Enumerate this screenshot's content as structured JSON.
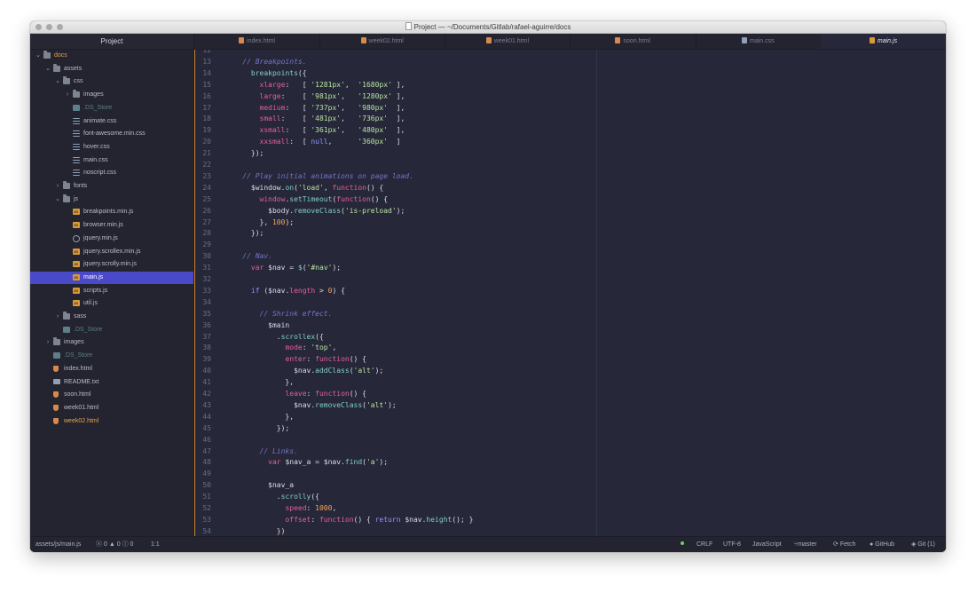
{
  "window": {
    "title": "Project — ~/Documents/Gitlab/rafael-aguirre/docs"
  },
  "tree": {
    "header": "Project",
    "items": [
      {
        "label": "docs",
        "icon": "folder-icon",
        "type": "folder",
        "expanded": true,
        "depth": 0,
        "style": "orange"
      },
      {
        "label": "assets",
        "icon": "folder-icon",
        "type": "folder",
        "expanded": true,
        "depth": 1,
        "style": ""
      },
      {
        "label": "css",
        "icon": "folder-icon",
        "type": "folder",
        "expanded": true,
        "depth": 2,
        "style": ""
      },
      {
        "label": "images",
        "icon": "folder-icon",
        "type": "folder",
        "expanded": false,
        "depth": 3,
        "style": ""
      },
      {
        "label": ".DS_Store",
        "icon": "ds-store-icon",
        "type": "ds",
        "depth": 3,
        "style": "dim"
      },
      {
        "label": "animate.css",
        "icon": "css-file-icon",
        "type": "css",
        "depth": 3,
        "style": ""
      },
      {
        "label": "font-awesome.min.css",
        "icon": "css-file-icon",
        "type": "css",
        "depth": 3,
        "style": ""
      },
      {
        "label": "hover.css",
        "icon": "css-file-icon",
        "type": "css",
        "depth": 3,
        "style": ""
      },
      {
        "label": "main.css",
        "icon": "css-file-icon",
        "type": "css",
        "depth": 3,
        "style": ""
      },
      {
        "label": "noscript.css",
        "icon": "css-file-icon",
        "type": "css",
        "depth": 3,
        "style": ""
      },
      {
        "label": "fonts",
        "icon": "folder-icon",
        "type": "folder",
        "expanded": false,
        "depth": 2,
        "style": ""
      },
      {
        "label": "js",
        "icon": "folder-icon",
        "type": "folder",
        "expanded": true,
        "depth": 2,
        "style": ""
      },
      {
        "label": "breakpoints.min.js",
        "icon": "js-file-icon",
        "type": "js",
        "depth": 3,
        "style": ""
      },
      {
        "label": "browser.min.js",
        "icon": "js-file-icon",
        "type": "js",
        "depth": 3,
        "style": ""
      },
      {
        "label": "jquery.min.js",
        "icon": "jquery-file-icon",
        "type": "jq",
        "depth": 3,
        "style": ""
      },
      {
        "label": "jquery.scrollex.min.js",
        "icon": "js-file-icon",
        "type": "js",
        "depth": 3,
        "style": ""
      },
      {
        "label": "jquery.scrolly.min.js",
        "icon": "js-file-icon",
        "type": "js",
        "depth": 3,
        "style": ""
      },
      {
        "label": "main.js",
        "icon": "js-file-icon",
        "type": "js",
        "depth": 3,
        "style": "selected"
      },
      {
        "label": "scripts.js",
        "icon": "js-file-icon",
        "type": "js",
        "depth": 3,
        "style": ""
      },
      {
        "label": "util.js",
        "icon": "js-file-icon",
        "type": "js",
        "depth": 3,
        "style": ""
      },
      {
        "label": "sass",
        "icon": "folder-icon",
        "type": "folder",
        "expanded": false,
        "depth": 2,
        "style": ""
      },
      {
        "label": ".DS_Store",
        "icon": "ds-store-icon",
        "type": "ds",
        "depth": 2,
        "style": "dim"
      },
      {
        "label": "images",
        "icon": "folder-icon",
        "type": "folder",
        "expanded": false,
        "depth": 1,
        "style": ""
      },
      {
        "label": ".DS_Store",
        "icon": "ds-store-icon",
        "type": "ds",
        "depth": 1,
        "style": "dim"
      },
      {
        "label": "index.html",
        "icon": "html-file-icon",
        "type": "html",
        "depth": 1,
        "style": ""
      },
      {
        "label": "README.txt",
        "icon": "text-file-icon",
        "type": "txt",
        "depth": 1,
        "style": ""
      },
      {
        "label": "soon.html",
        "icon": "html-file-icon",
        "type": "html",
        "depth": 1,
        "style": ""
      },
      {
        "label": "week01.html",
        "icon": "html-file-icon",
        "type": "html",
        "depth": 1,
        "style": ""
      },
      {
        "label": "week02.html",
        "icon": "html-file-icon",
        "type": "html",
        "depth": 1,
        "style": "orange"
      }
    ]
  },
  "tabs": [
    {
      "label": "index.html",
      "icon": "html-file-icon",
      "kind": "html",
      "active": false
    },
    {
      "label": "week02.html",
      "icon": "html-file-icon",
      "kind": "html",
      "active": false
    },
    {
      "label": "week01.html",
      "icon": "html-file-icon",
      "kind": "html",
      "active": false
    },
    {
      "label": "soon.html",
      "icon": "html-file-icon",
      "kind": "html",
      "active": false
    },
    {
      "label": "main.css",
      "icon": "css-file-icon",
      "kind": "css",
      "active": false
    },
    {
      "label": "main.js",
      "icon": "js-file-icon",
      "kind": "js",
      "active": true
    }
  ],
  "editor": {
    "first_line": 12,
    "lines": [
      [],
      [
        [
          "    ",
          "c-plain"
        ],
        [
          "// Breakpoints.",
          "c-comment"
        ]
      ],
      [
        [
          "      ",
          "c-plain"
        ],
        [
          "breakpoints",
          "c-fn"
        ],
        [
          "({",
          "c-plain"
        ]
      ],
      [
        [
          "        ",
          "c-plain"
        ],
        [
          "xlarge",
          "c-prop"
        ],
        [
          ":   [ ",
          "c-plain"
        ],
        [
          "'1281px'",
          "c-str"
        ],
        [
          ",  ",
          "c-plain"
        ],
        [
          "'1680px'",
          "c-str"
        ],
        [
          " ],",
          "c-plain"
        ]
      ],
      [
        [
          "        ",
          "c-plain"
        ],
        [
          "large",
          "c-prop"
        ],
        [
          ":    [ ",
          "c-plain"
        ],
        [
          "'981px'",
          "c-str"
        ],
        [
          ",   ",
          "c-plain"
        ],
        [
          "'1280px'",
          "c-str"
        ],
        [
          " ],",
          "c-plain"
        ]
      ],
      [
        [
          "        ",
          "c-plain"
        ],
        [
          "medium",
          "c-prop"
        ],
        [
          ":   [ ",
          "c-plain"
        ],
        [
          "'737px'",
          "c-str"
        ],
        [
          ",   ",
          "c-plain"
        ],
        [
          "'980px'",
          "c-str"
        ],
        [
          "  ],",
          "c-plain"
        ]
      ],
      [
        [
          "        ",
          "c-plain"
        ],
        [
          "small",
          "c-prop"
        ],
        [
          ":    [ ",
          "c-plain"
        ],
        [
          "'481px'",
          "c-str"
        ],
        [
          ",   ",
          "c-plain"
        ],
        [
          "'736px'",
          "c-str"
        ],
        [
          "  ],",
          "c-plain"
        ]
      ],
      [
        [
          "        ",
          "c-plain"
        ],
        [
          "xsmall",
          "c-prop"
        ],
        [
          ":   [ ",
          "c-plain"
        ],
        [
          "'361px'",
          "c-str"
        ],
        [
          ",   ",
          "c-plain"
        ],
        [
          "'480px'",
          "c-str"
        ],
        [
          "  ],",
          "c-plain"
        ]
      ],
      [
        [
          "        ",
          "c-plain"
        ],
        [
          "xxsmall",
          "c-prop"
        ],
        [
          ":  [ ",
          "c-plain"
        ],
        [
          "null",
          "c-const"
        ],
        [
          ",      ",
          "c-plain"
        ],
        [
          "'360px'",
          "c-str"
        ],
        [
          "  ]",
          "c-plain"
        ]
      ],
      [
        [
          "      });",
          "c-plain"
        ]
      ],
      [],
      [
        [
          "    ",
          "c-plain"
        ],
        [
          "// Play initial animations on page load.",
          "c-comment"
        ]
      ],
      [
        [
          "      $window.",
          "c-plain"
        ],
        [
          "on",
          "c-fn"
        ],
        [
          "(",
          "c-plain"
        ],
        [
          "'load'",
          "c-str"
        ],
        [
          ", ",
          "c-plain"
        ],
        [
          "function",
          "c-kw"
        ],
        [
          "() {",
          "c-plain"
        ]
      ],
      [
        [
          "        ",
          "c-plain"
        ],
        [
          "window",
          "c-kw"
        ],
        [
          ".",
          "c-plain"
        ],
        [
          "setTimeout",
          "c-fn"
        ],
        [
          "(",
          "c-plain"
        ],
        [
          "function",
          "c-kw"
        ],
        [
          "() {",
          "c-plain"
        ]
      ],
      [
        [
          "          $body.",
          "c-plain"
        ],
        [
          "removeClass",
          "c-fn"
        ],
        [
          "(",
          "c-plain"
        ],
        [
          "'is-preload'",
          "c-str"
        ],
        [
          ");",
          "c-plain"
        ]
      ],
      [
        [
          "        }, ",
          "c-plain"
        ],
        [
          "100",
          "c-num"
        ],
        [
          ");",
          "c-plain"
        ]
      ],
      [
        [
          "      });",
          "c-plain"
        ]
      ],
      [],
      [
        [
          "    ",
          "c-plain"
        ],
        [
          "// Nav.",
          "c-comment"
        ]
      ],
      [
        [
          "      ",
          "c-plain"
        ],
        [
          "var",
          "c-kw"
        ],
        [
          " $nav = ",
          "c-plain"
        ],
        [
          "$",
          "c-fn"
        ],
        [
          "(",
          "c-plain"
        ],
        [
          "'#nav'",
          "c-str"
        ],
        [
          ");",
          "c-plain"
        ]
      ],
      [],
      [
        [
          "      ",
          "c-plain"
        ],
        [
          "if",
          "c-const"
        ],
        [
          " ($nav.",
          "c-plain"
        ],
        [
          "length",
          "c-prop"
        ],
        [
          " > ",
          "c-plain"
        ],
        [
          "0",
          "c-num"
        ],
        [
          ") {",
          "c-plain"
        ]
      ],
      [],
      [
        [
          "        ",
          "c-plain"
        ],
        [
          "// Shrink effect.",
          "c-comment"
        ]
      ],
      [
        [
          "          $main",
          "c-plain"
        ]
      ],
      [
        [
          "            .",
          "c-plain"
        ],
        [
          "scrollex",
          "c-fn"
        ],
        [
          "({",
          "c-plain"
        ]
      ],
      [
        [
          "              ",
          "c-plain"
        ],
        [
          "mode",
          "c-prop"
        ],
        [
          ": ",
          "c-plain"
        ],
        [
          "'top'",
          "c-str"
        ],
        [
          ",",
          "c-plain"
        ]
      ],
      [
        [
          "              ",
          "c-plain"
        ],
        [
          "enter",
          "c-prop"
        ],
        [
          ": ",
          "c-plain"
        ],
        [
          "function",
          "c-kw"
        ],
        [
          "() {",
          "c-plain"
        ]
      ],
      [
        [
          "                $nav.",
          "c-plain"
        ],
        [
          "addClass",
          "c-fn"
        ],
        [
          "(",
          "c-plain"
        ],
        [
          "'alt'",
          "c-str"
        ],
        [
          ");",
          "c-plain"
        ]
      ],
      [
        [
          "              },",
          "c-plain"
        ]
      ],
      [
        [
          "              ",
          "c-plain"
        ],
        [
          "leave",
          "c-prop"
        ],
        [
          ": ",
          "c-plain"
        ],
        [
          "function",
          "c-kw"
        ],
        [
          "() {",
          "c-plain"
        ]
      ],
      [
        [
          "                $nav.",
          "c-plain"
        ],
        [
          "removeClass",
          "c-fn"
        ],
        [
          "(",
          "c-plain"
        ],
        [
          "'alt'",
          "c-str"
        ],
        [
          ");",
          "c-plain"
        ]
      ],
      [
        [
          "              },",
          "c-plain"
        ]
      ],
      [
        [
          "            });",
          "c-plain"
        ]
      ],
      [],
      [
        [
          "        ",
          "c-plain"
        ],
        [
          "// Links.",
          "c-comment"
        ]
      ],
      [
        [
          "          ",
          "c-plain"
        ],
        [
          "var",
          "c-kw"
        ],
        [
          " $nav_a = $nav.",
          "c-plain"
        ],
        [
          "find",
          "c-fn"
        ],
        [
          "(",
          "c-plain"
        ],
        [
          "'a'",
          "c-str"
        ],
        [
          ");",
          "c-plain"
        ]
      ],
      [],
      [
        [
          "          $nav_a",
          "c-plain"
        ]
      ],
      [
        [
          "            .",
          "c-plain"
        ],
        [
          "scrolly",
          "c-fn"
        ],
        [
          "({",
          "c-plain"
        ]
      ],
      [
        [
          "              ",
          "c-plain"
        ],
        [
          "speed",
          "c-prop"
        ],
        [
          ": ",
          "c-plain"
        ],
        [
          "1000",
          "c-num"
        ],
        [
          ",",
          "c-plain"
        ]
      ],
      [
        [
          "              ",
          "c-plain"
        ],
        [
          "offset",
          "c-prop"
        ],
        [
          ": ",
          "c-plain"
        ],
        [
          "function",
          "c-kw"
        ],
        [
          "() { ",
          "c-plain"
        ],
        [
          "return",
          "c-const"
        ],
        [
          " $nav.",
          "c-plain"
        ],
        [
          "height",
          "c-fn"
        ],
        [
          "(); }",
          "c-plain"
        ]
      ],
      [
        [
          "            })",
          "c-plain"
        ]
      ]
    ]
  },
  "status": {
    "path": "assets/js/main.js",
    "errors": "0",
    "warnings": "0",
    "infos": "0",
    "cursor": "1:1",
    "line_ending": "CRLF",
    "encoding": "UTF-8",
    "grammar": "JavaScript",
    "branch": "master",
    "fetch": "Fetch",
    "github": "GitHub",
    "git": "Git (1)"
  }
}
